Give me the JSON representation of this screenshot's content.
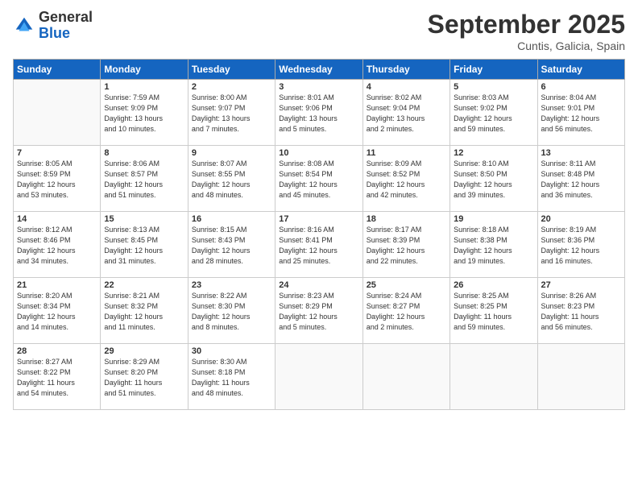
{
  "logo": {
    "general": "General",
    "blue": "Blue"
  },
  "title": "September 2025",
  "location": "Cuntis, Galicia, Spain",
  "headers": [
    "Sunday",
    "Monday",
    "Tuesday",
    "Wednesday",
    "Thursday",
    "Friday",
    "Saturday"
  ],
  "weeks": [
    [
      {
        "day": "",
        "info": ""
      },
      {
        "day": "1",
        "info": "Sunrise: 7:59 AM\nSunset: 9:09 PM\nDaylight: 13 hours\nand 10 minutes."
      },
      {
        "day": "2",
        "info": "Sunrise: 8:00 AM\nSunset: 9:07 PM\nDaylight: 13 hours\nand 7 minutes."
      },
      {
        "day": "3",
        "info": "Sunrise: 8:01 AM\nSunset: 9:06 PM\nDaylight: 13 hours\nand 5 minutes."
      },
      {
        "day": "4",
        "info": "Sunrise: 8:02 AM\nSunset: 9:04 PM\nDaylight: 13 hours\nand 2 minutes."
      },
      {
        "day": "5",
        "info": "Sunrise: 8:03 AM\nSunset: 9:02 PM\nDaylight: 12 hours\nand 59 minutes."
      },
      {
        "day": "6",
        "info": "Sunrise: 8:04 AM\nSunset: 9:01 PM\nDaylight: 12 hours\nand 56 minutes."
      }
    ],
    [
      {
        "day": "7",
        "info": "Sunrise: 8:05 AM\nSunset: 8:59 PM\nDaylight: 12 hours\nand 53 minutes."
      },
      {
        "day": "8",
        "info": "Sunrise: 8:06 AM\nSunset: 8:57 PM\nDaylight: 12 hours\nand 51 minutes."
      },
      {
        "day": "9",
        "info": "Sunrise: 8:07 AM\nSunset: 8:55 PM\nDaylight: 12 hours\nand 48 minutes."
      },
      {
        "day": "10",
        "info": "Sunrise: 8:08 AM\nSunset: 8:54 PM\nDaylight: 12 hours\nand 45 minutes."
      },
      {
        "day": "11",
        "info": "Sunrise: 8:09 AM\nSunset: 8:52 PM\nDaylight: 12 hours\nand 42 minutes."
      },
      {
        "day": "12",
        "info": "Sunrise: 8:10 AM\nSunset: 8:50 PM\nDaylight: 12 hours\nand 39 minutes."
      },
      {
        "day": "13",
        "info": "Sunrise: 8:11 AM\nSunset: 8:48 PM\nDaylight: 12 hours\nand 36 minutes."
      }
    ],
    [
      {
        "day": "14",
        "info": "Sunrise: 8:12 AM\nSunset: 8:46 PM\nDaylight: 12 hours\nand 34 minutes."
      },
      {
        "day": "15",
        "info": "Sunrise: 8:13 AM\nSunset: 8:45 PM\nDaylight: 12 hours\nand 31 minutes."
      },
      {
        "day": "16",
        "info": "Sunrise: 8:15 AM\nSunset: 8:43 PM\nDaylight: 12 hours\nand 28 minutes."
      },
      {
        "day": "17",
        "info": "Sunrise: 8:16 AM\nSunset: 8:41 PM\nDaylight: 12 hours\nand 25 minutes."
      },
      {
        "day": "18",
        "info": "Sunrise: 8:17 AM\nSunset: 8:39 PM\nDaylight: 12 hours\nand 22 minutes."
      },
      {
        "day": "19",
        "info": "Sunrise: 8:18 AM\nSunset: 8:38 PM\nDaylight: 12 hours\nand 19 minutes."
      },
      {
        "day": "20",
        "info": "Sunrise: 8:19 AM\nSunset: 8:36 PM\nDaylight: 12 hours\nand 16 minutes."
      }
    ],
    [
      {
        "day": "21",
        "info": "Sunrise: 8:20 AM\nSunset: 8:34 PM\nDaylight: 12 hours\nand 14 minutes."
      },
      {
        "day": "22",
        "info": "Sunrise: 8:21 AM\nSunset: 8:32 PM\nDaylight: 12 hours\nand 11 minutes."
      },
      {
        "day": "23",
        "info": "Sunrise: 8:22 AM\nSunset: 8:30 PM\nDaylight: 12 hours\nand 8 minutes."
      },
      {
        "day": "24",
        "info": "Sunrise: 8:23 AM\nSunset: 8:29 PM\nDaylight: 12 hours\nand 5 minutes."
      },
      {
        "day": "25",
        "info": "Sunrise: 8:24 AM\nSunset: 8:27 PM\nDaylight: 12 hours\nand 2 minutes."
      },
      {
        "day": "26",
        "info": "Sunrise: 8:25 AM\nSunset: 8:25 PM\nDaylight: 11 hours\nand 59 minutes."
      },
      {
        "day": "27",
        "info": "Sunrise: 8:26 AM\nSunset: 8:23 PM\nDaylight: 11 hours\nand 56 minutes."
      }
    ],
    [
      {
        "day": "28",
        "info": "Sunrise: 8:27 AM\nSunset: 8:22 PM\nDaylight: 11 hours\nand 54 minutes."
      },
      {
        "day": "29",
        "info": "Sunrise: 8:29 AM\nSunset: 8:20 PM\nDaylight: 11 hours\nand 51 minutes."
      },
      {
        "day": "30",
        "info": "Sunrise: 8:30 AM\nSunset: 8:18 PM\nDaylight: 11 hours\nand 48 minutes."
      },
      {
        "day": "",
        "info": ""
      },
      {
        "day": "",
        "info": ""
      },
      {
        "day": "",
        "info": ""
      },
      {
        "day": "",
        "info": ""
      }
    ]
  ]
}
